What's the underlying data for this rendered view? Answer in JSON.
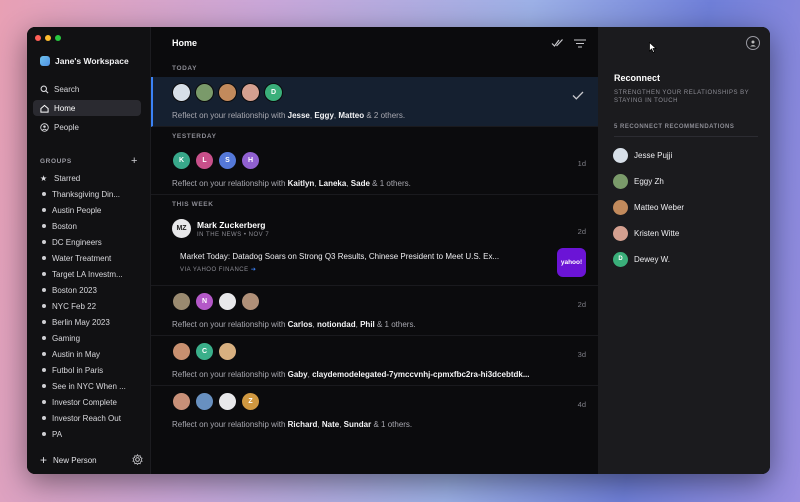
{
  "colors": {
    "accent": "#3b82f6",
    "background": "#0b0b0d",
    "right_panel": "#1b1b1e"
  },
  "sidebar": {
    "workspace": "Jane's Workspace",
    "nav": [
      {
        "label": "Search",
        "icon": "search-icon"
      },
      {
        "label": "Home",
        "icon": "home-icon",
        "active": true
      },
      {
        "label": "People",
        "icon": "people-icon"
      }
    ],
    "groups_label": "GROUPS",
    "groups": [
      "Starred",
      "Thanksgiving Din...",
      "Austin People",
      "Boston",
      "DC Engineers",
      "Water Treatment",
      "Target LA Investm...",
      "Boston 2023",
      "NYC Feb 22",
      "Berlin May 2023",
      "Gaming",
      "Austin in May",
      "Futbol in Paris",
      "See in NYC When ...",
      "Investor Complete",
      "Investor Reach Out",
      "PA"
    ],
    "new_person": "New Person"
  },
  "main": {
    "title": "Home",
    "sections": {
      "today": "TODAY",
      "yesterday": "YESTERDAY",
      "this_week": "THIS WEEK"
    },
    "feed": [
      {
        "prefix": "Reflect on your relationship with",
        "names": [
          "Jesse",
          "Eggy",
          "Matteo"
        ],
        "suffix": "& 2 others.",
        "time": "",
        "avatars": [
          {
            "l": "",
            "c": "#d7dfe8"
          },
          {
            "l": "",
            "c": "#7a9a6a"
          },
          {
            "l": "",
            "c": "#c28a5c"
          },
          {
            "l": "",
            "c": "#d4a090"
          },
          {
            "l": "D",
            "c": "#3aaf7a"
          }
        ]
      },
      {
        "prefix": "Reflect on your relationship with",
        "names": [
          "Kaitlyn",
          "Laneka",
          "Sade"
        ],
        "suffix": "& 1 others.",
        "time": "1d",
        "avatars": [
          {
            "l": "K",
            "c": "#38a88a"
          },
          {
            "l": "L",
            "c": "#c8508a"
          },
          {
            "l": "S",
            "c": "#5478d8"
          },
          {
            "l": "H",
            "c": "#9060d0"
          }
        ]
      },
      {
        "prefix": "Reflect on your relationship with",
        "names": [
          "Carlos",
          "notiondad",
          "Phil"
        ],
        "suffix": "& 1 others.",
        "time": "2d",
        "avatars": [
          {
            "l": "",
            "c": "#9a8a70"
          },
          {
            "l": "N",
            "c": "#b458c8"
          },
          {
            "l": "",
            "c": "#e8e8ea"
          },
          {
            "l": "",
            "c": "#b09078"
          }
        ]
      },
      {
        "prefix": "Reflect on your relationship with",
        "names": [
          "Gaby",
          "claydemodelegated-7ymccvnhj-cpmxfbc2ra-hi3dcebtdk..."
        ],
        "suffix": "",
        "time": "3d",
        "avatars": [
          {
            "l": "",
            "c": "#c89070"
          },
          {
            "l": "C",
            "c": "#3aaf8a"
          },
          {
            "l": "",
            "c": "#d8b080"
          }
        ]
      },
      {
        "prefix": "Reflect on your relationship with",
        "names": [
          "Richard",
          "Nate",
          "Sundar"
        ],
        "suffix": "& 1 others.",
        "time": "4d",
        "avatars": [
          {
            "l": "",
            "c": "#c89078"
          },
          {
            "l": "",
            "c": "#6890c0"
          },
          {
            "l": "",
            "c": "#e8e8ea"
          },
          {
            "l": "Z",
            "c": "#d09840"
          }
        ]
      }
    ],
    "news": {
      "name": "Mark Zuckerberg",
      "sub": "IN THE NEWS • NOV 7",
      "time": "2d",
      "headline": "Market Today: Datadog Soars on Strong Q3 Results, Chinese President to Meet U.S. Ex...",
      "via": "VIA YAHOO FINANCE",
      "via_arrow": "➔",
      "thumb": "yahoo!"
    }
  },
  "right": {
    "title": "Reconnect",
    "subtitle": "STRENGTHEN YOUR RELATIONSHIPS BY STAYING IN TOUCH",
    "count_label": "5 RECONNECT RECOMMENDATIONS",
    "people": [
      {
        "name": "Jesse Pujji",
        "c": "#d7dfe8",
        "l": ""
      },
      {
        "name": "Eggy Zh",
        "c": "#7a9a6a",
        "l": ""
      },
      {
        "name": "Matteo Weber",
        "c": "#c28a5c",
        "l": ""
      },
      {
        "name": "Kristen Witte",
        "c": "#d4a090",
        "l": ""
      },
      {
        "name": "Dewey W.",
        "c": "#3aaf7a",
        "l": "D"
      }
    ]
  }
}
